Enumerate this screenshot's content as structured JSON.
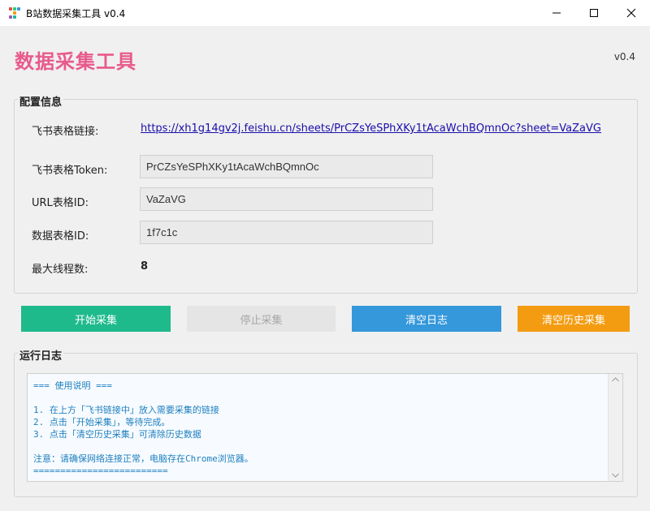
{
  "window": {
    "title": "B站数据采集工具 v0.4",
    "controls": {
      "minimize": "minimize-icon",
      "maximize": "maximize-icon",
      "close": "close-icon"
    }
  },
  "header": {
    "title": "数据采集工具",
    "version": "v0.4",
    "title_color": "#e85a8c"
  },
  "config": {
    "section_label": "配置信息",
    "feishu_link_label": "飞书表格链接:",
    "feishu_link": "https://xh1g14gv2j.feishu.cn/sheets/PrCZsYeSPhXKy1tAcaWchBQmnOc?sheet=VaZaVG",
    "token_label": "飞书表格Token:",
    "token_value": "PrCZsYeSPhXKy1tAcaWchBQmnOc",
    "url_id_label": "URL表格ID:",
    "url_id_value": "VaZaVG",
    "data_id_label": "数据表格ID:",
    "data_id_value": "1f7c1c",
    "threads_label": "最大线程数:",
    "threads_value": "8"
  },
  "buttons": {
    "start": {
      "label": "开始采集",
      "color": "#1fba8c"
    },
    "stop": {
      "label": "停止采集",
      "color": "#e5e5e5"
    },
    "clear_log": {
      "label": "清空日志",
      "color": "#3498db"
    },
    "clear_history": {
      "label": "清空历史采集",
      "color": "#f39c12"
    }
  },
  "log": {
    "section_label": "运行日志",
    "lines": [
      "=== 使用说明 ===",
      "",
      "1. 在上方「飞书链接中」放入需要采集的链接",
      "2. 点击「开始采集」，等待完成。",
      "3. 点击「清空历史采集」可清除历史数据",
      "",
      "注意：请确保网络连接正常，电脑存在Chrome浏览器。",
      "========================="
    ],
    "text_color": "#1e7fbf"
  }
}
